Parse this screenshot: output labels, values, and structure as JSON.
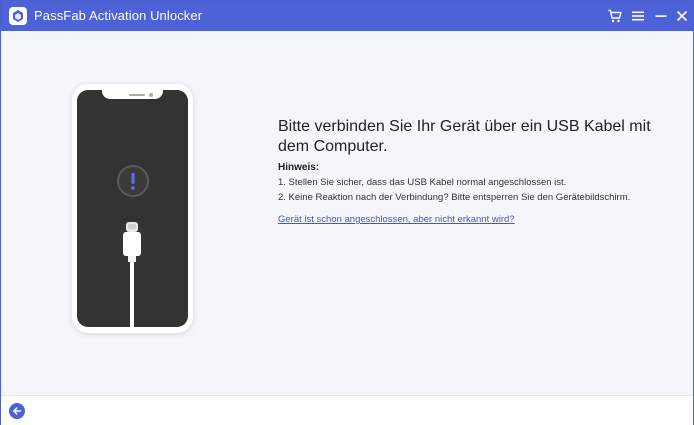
{
  "app": {
    "title": "PassFab Activation Unlocker",
    "accent_color": "#4c62d6"
  },
  "titlebar": {
    "cart_icon": "cart-icon",
    "menu_icon": "hamburger-menu-icon",
    "minimize_icon": "minimize-icon",
    "close_icon": "close-icon"
  },
  "main": {
    "headline": "Bitte verbinden Sie Ihr Gerät über ein USB Kabel mit dem Computer.",
    "hint_title": "Hinweis:",
    "hints": [
      "1. Stellen Sie sicher, dass das USB Kabel normal angeschlossen ist.",
      "2. Keine Reaktion nach der Verbindung? Bitte entsperren Sie den Gerätebildschirm."
    ],
    "help_link": "Gerät ist schon angeschlossen, aber nicht erkannt wird?"
  },
  "illustration": {
    "phone_icon": "smartphone-illustration",
    "alert_icon": "exclamation-icon",
    "cable_icon": "usb-cable-icon"
  },
  "footer": {
    "back_icon": "back-arrow-icon"
  }
}
